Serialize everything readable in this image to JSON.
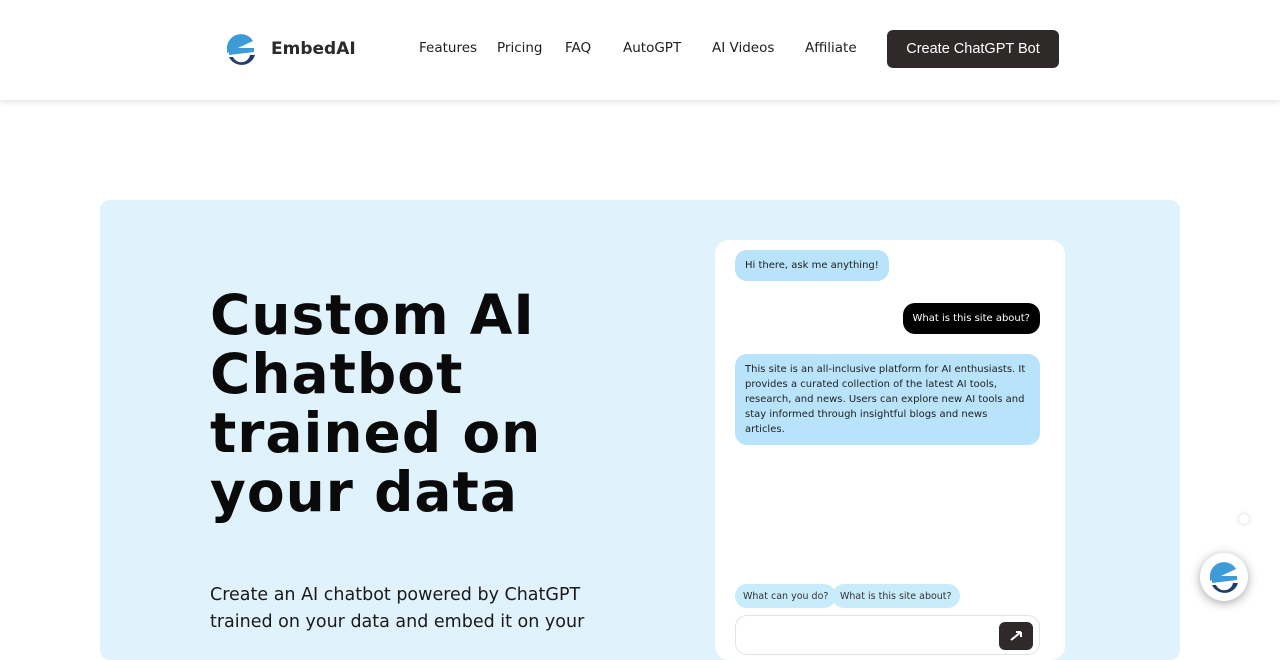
{
  "brand": {
    "name": "EmbedAI",
    "logo_icon": "embedai-logo-icon",
    "primary_blue": "#3d9bd8",
    "dark_blue": "#1f3f66"
  },
  "nav": {
    "items": [
      {
        "label": "Features"
      },
      {
        "label": "Pricing"
      },
      {
        "label": "FAQ"
      },
      {
        "label": "AutoGPT"
      },
      {
        "label": "AI Videos"
      },
      {
        "label": "Affiliate"
      }
    ],
    "cta_label": "Create ChatGPT Bot"
  },
  "hero": {
    "title": "Custom AI Chatbot trained on your data",
    "subtitle": "Create an AI chatbot powered by ChatGPT trained on your data and embed it on your"
  },
  "chat": {
    "messages": [
      {
        "role": "bot",
        "text": "Hi there, ask me anything!"
      },
      {
        "role": "user",
        "text": "What is this site about?"
      },
      {
        "role": "bot",
        "text": "This site is an all-inclusive platform for AI enthusiasts. It provides a curated collection of the latest AI tools, research, and news. Users can explore new AI tools and stay informed through insightful blogs and news articles."
      }
    ],
    "suggestions": [
      "What can you do?",
      "What is this site about?"
    ],
    "send_icon": "send-icon"
  },
  "widget": {
    "icon": "chat-widget-icon"
  }
}
